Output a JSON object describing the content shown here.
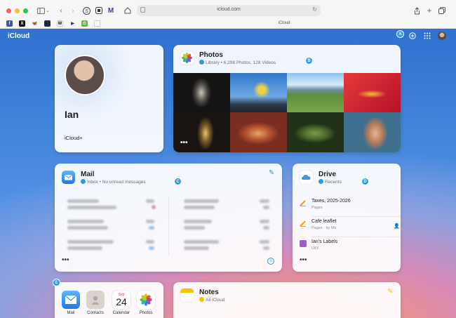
{
  "browser": {
    "url": "icloud.com",
    "tab_title": "iCloud"
  },
  "header": {
    "logo": "iCloud"
  },
  "badges": {
    "a": "A",
    "b": "B",
    "c": "C",
    "d": "D",
    "e": "E"
  },
  "profile": {
    "name": "Ian",
    "plan": "iCloud+"
  },
  "photos": {
    "title": "Photos",
    "subtitle": "Library • 6,298 Photos, 128 Videos",
    "more": "•••"
  },
  "mail": {
    "title": "Mail",
    "subtitle": "Inbox • No unread messages",
    "more": "•••"
  },
  "drive": {
    "title": "Drive",
    "subtitle": "Recents",
    "more": "•••",
    "files": [
      {
        "name": "Taxes, 2025-2026",
        "sub": "Pages"
      },
      {
        "name": "Cafe leaflet",
        "sub": "Pages · by Me"
      },
      {
        "name": "Ian's Labels",
        "sub": "LBX"
      }
    ]
  },
  "apps": [
    {
      "label": "Mail"
    },
    {
      "label": "Contacts"
    },
    {
      "label": "Calendar",
      "day": "24",
      "month": "Sep"
    },
    {
      "label": "Photos"
    }
  ],
  "notes": {
    "title": "Notes",
    "subtitle": "All iCloud"
  },
  "colors": {
    "accent": "#2f9bd9",
    "notes_yellow": "#f5c400",
    "pages_orange": "#f39a1e"
  }
}
